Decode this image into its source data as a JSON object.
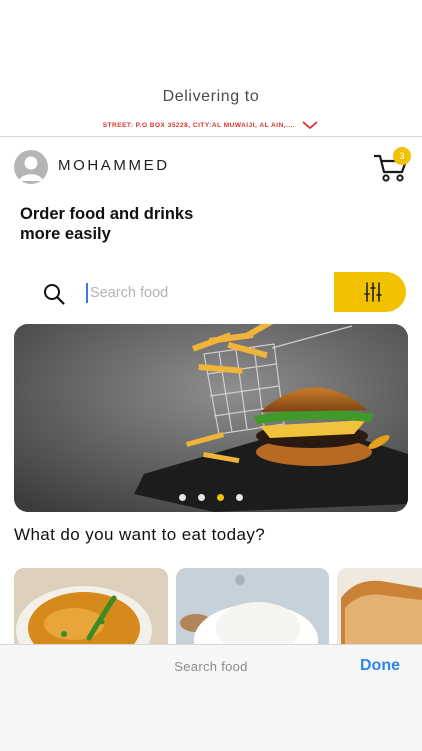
{
  "header": {
    "delivering_label": "Delivering to",
    "address": "STREET: P.O BOX 35228, CITY:AL MUWAIJI, AL AIN,...."
  },
  "user": {
    "name": "MOHAMMED"
  },
  "cart": {
    "count": "3"
  },
  "headline": {
    "line1": "Order food and drinks",
    "line2": "more easily"
  },
  "search": {
    "placeholder": "Search food",
    "value": ""
  },
  "carousel": {
    "slide_count": 4,
    "active_index": 2
  },
  "categories": {
    "title": "What do you want to eat today?"
  },
  "keyboard_bar": {
    "label": "Search food",
    "done": "Done"
  },
  "colors": {
    "accent": "#f2c200",
    "address_red": "#d9312b",
    "done_blue": "#2e86e6"
  }
}
